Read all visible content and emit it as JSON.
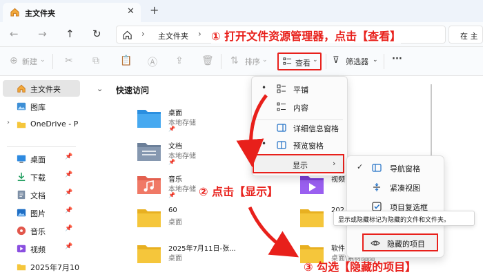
{
  "tab": {
    "title": "主文件夹",
    "close": "✕",
    "new": "+"
  },
  "nav": {
    "back": "←",
    "forward": "→",
    "up": "↑",
    "refresh": "↻"
  },
  "address": {
    "sep": "›",
    "crumb": "主文件夹",
    "search_placeholder": "在 主"
  },
  "toolbar": {
    "new_label": "新建",
    "sort_label": "排序",
    "view_label": "查看",
    "filter_label": "筛选器",
    "more": "···",
    "caret": "⌄"
  },
  "sidebar": {
    "items": [
      {
        "label": "主文件夹",
        "pin": ""
      },
      {
        "label": "图库",
        "pin": ""
      },
      {
        "label": "OneDrive - P",
        "pin": ""
      },
      {
        "label": "桌面",
        "pin": "📌"
      },
      {
        "label": "下载",
        "pin": "📌"
      },
      {
        "label": "文档",
        "pin": "📌"
      },
      {
        "label": "图片",
        "pin": "📌"
      },
      {
        "label": "音乐",
        "pin": "📌"
      },
      {
        "label": "视频",
        "pin": "📌"
      },
      {
        "label": "2025年7月10",
        "pin": ""
      }
    ],
    "chevron": "›"
  },
  "main": {
    "qa_title": "快速访问",
    "qa_chevron": "⌄",
    "files": [
      {
        "name": "桌面",
        "sub": "本地存储",
        "pin": "📌"
      },
      {
        "name": "文档",
        "sub": "本地存储",
        "pin": "📌"
      },
      {
        "name": "音乐",
        "sub": "本地存储",
        "pin": "📌"
      },
      {
        "name": "60",
        "sub": "桌面",
        "pin": ""
      },
      {
        "name": "2025年7月11日-张...",
        "sub": "桌面",
        "pin": ""
      },
      {
        "name": "视频",
        "sub": "",
        "pin": ""
      },
      {
        "name": "202",
        "sub": "",
        "pin": ""
      },
      {
        "name": "软件",
        "sub": "桌面\\素材图图",
        "pin": ""
      }
    ]
  },
  "view_menu": {
    "items": [
      {
        "label": "平铺",
        "dot": "•"
      },
      {
        "label": "内容",
        "dot": ""
      },
      {
        "label": "详细信息窗格",
        "dot": ""
      },
      {
        "label": "预览窗格",
        "dot": "•"
      }
    ],
    "show_label": "显示",
    "arrow": "›"
  },
  "show_submenu": {
    "items": [
      {
        "label": "导航窗格",
        "check": "✓"
      },
      {
        "label": "紧凑视图",
        "check": ""
      },
      {
        "label": "项目复选框",
        "check": ""
      }
    ],
    "hidden_label": "隐藏的项目"
  },
  "tooltip": "显示或隐藏标记为隐藏的文件和文件夹。",
  "annotations": {
    "step1": "① 打开文件资源管理器，点击【查看】",
    "step2": "② 点击【显示】",
    "step3": "③ 勾选【隐藏的项目】"
  },
  "colors": {
    "accent_red": "#e8201b",
    "folder_yellow": "#f5c63b",
    "folder_blue": "#3d8fd6",
    "folder_purple": "#8a4fe0",
    "icon_blue": "#1f6fc5"
  }
}
